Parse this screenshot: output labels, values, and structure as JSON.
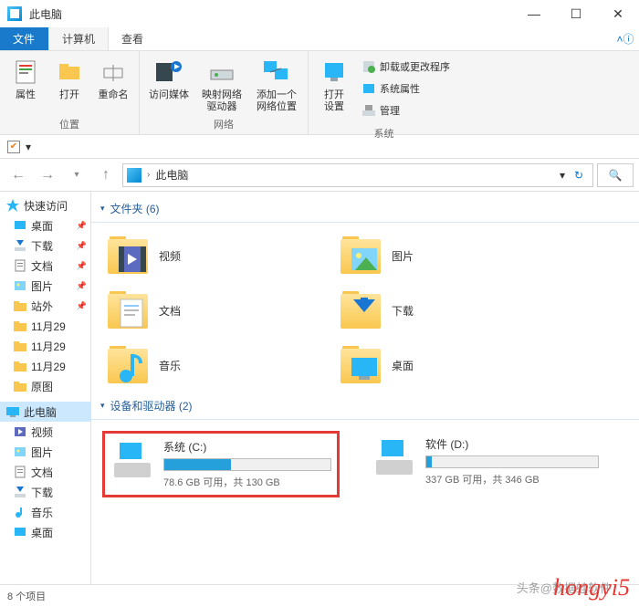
{
  "window": {
    "title": "此电脑",
    "controls": {
      "min": "—",
      "max": "☐",
      "close": "✕"
    }
  },
  "tabs": {
    "file": "文件",
    "computer": "计算机",
    "view": "查看",
    "help": "ⓘ"
  },
  "ribbon": {
    "loc_group": "位置",
    "net_group": "网络",
    "sys_group": "系统",
    "properties": "属性",
    "open": "打开",
    "rename": "重命名",
    "media": "访问媒体",
    "mapdrive": "映射网络\n驱动器",
    "addnet": "添加一个\n网络位置",
    "opensettings": "打开\n设置",
    "uninstall": "卸载或更改程序",
    "sysprops": "系统属性",
    "manage": "管理"
  },
  "qat": {
    "caret": "▾"
  },
  "nav": {
    "back": "←",
    "fwd": "→",
    "recent": "▾",
    "up": "↑",
    "crumb_sep": "›",
    "location": "此电脑",
    "refresh": "↻",
    "search": "🔍"
  },
  "sidebar": {
    "quick": "快速访问",
    "items": [
      {
        "label": "桌面",
        "pin": true
      },
      {
        "label": "下载",
        "pin": true
      },
      {
        "label": "文档",
        "pin": true
      },
      {
        "label": "图片",
        "pin": true
      },
      {
        "label": "站外",
        "pin": true
      },
      {
        "label": "11月29",
        "pin": false
      },
      {
        "label": "11月29",
        "pin": false
      },
      {
        "label": "11月29",
        "pin": false
      },
      {
        "label": "原图",
        "pin": false
      }
    ],
    "thispc": "此电脑",
    "pcitems": [
      {
        "label": "视频"
      },
      {
        "label": "图片"
      },
      {
        "label": "文档"
      },
      {
        "label": "下载"
      },
      {
        "label": "音乐"
      },
      {
        "label": "桌面"
      }
    ]
  },
  "main": {
    "folders_header": "文件夹 (6)",
    "drives_header": "设备和驱动器 (2)",
    "folders": [
      {
        "label": "视频"
      },
      {
        "label": "图片"
      },
      {
        "label": "文档"
      },
      {
        "label": "下载"
      },
      {
        "label": "音乐"
      },
      {
        "label": "桌面"
      }
    ],
    "drives": [
      {
        "name": "系统 (C:)",
        "sub": "78.6 GB 可用，共 130 GB",
        "fill_pct": 40,
        "highlight": true
      },
      {
        "name": "软件 (D:)",
        "sub": "337 GB 可用，共 346 GB",
        "fill_pct": 3,
        "highlight": false
      }
    ]
  },
  "status": {
    "text": "8 个项目"
  },
  "watermark": {
    "text1": "hongyi5",
    "text2": "头条@数据蛙软件"
  }
}
